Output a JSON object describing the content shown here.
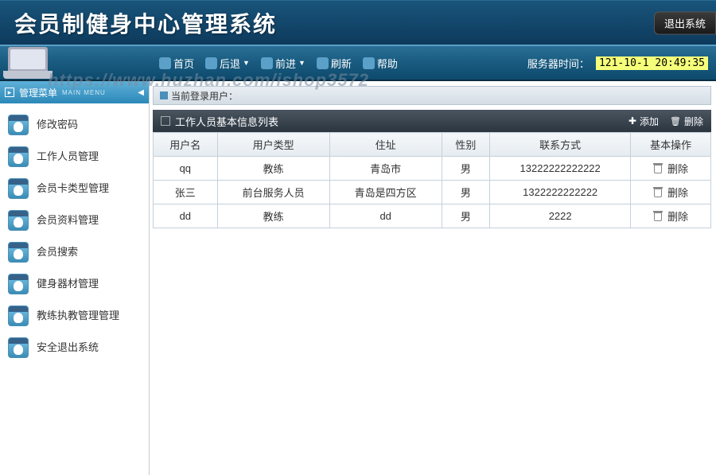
{
  "app_title": "会员制健身中心管理系统",
  "logout_label": "退出系统",
  "watermark": "https://www.huzhan.com/ishop3572",
  "nav": {
    "home": "首页",
    "back": "后退",
    "forward": "前进",
    "refresh": "刷新",
    "help": "帮助"
  },
  "server_time": {
    "label": "服务器时间：",
    "value": "121-10-1 20:49:35"
  },
  "sidebar": {
    "title": "管理菜单",
    "subtitle": "MAIN MENU",
    "items": [
      {
        "label": "修改密码"
      },
      {
        "label": "工作人员管理"
      },
      {
        "label": "会员卡类型管理"
      },
      {
        "label": "会员资料管理"
      },
      {
        "label": "会员搜索"
      },
      {
        "label": "健身器材管理"
      },
      {
        "label": "教练执教管理管理"
      },
      {
        "label": "安全退出系统"
      }
    ]
  },
  "breadcrumb": "当前登录用户：",
  "panel": {
    "title": "工作人员基本信息列表",
    "add": "添加",
    "delete": "删除"
  },
  "table": {
    "headers": [
      "用户名",
      "用户类型",
      "住址",
      "性别",
      "联系方式",
      "基本操作"
    ],
    "action_label": "删除",
    "rows": [
      {
        "username": "qq",
        "type": "教练",
        "addr": "青岛市",
        "gender": "男",
        "contact": "13222222222222"
      },
      {
        "username": "张三",
        "type": "前台服务人员",
        "addr": "青岛是四方区",
        "gender": "男",
        "contact": "1322222222222"
      },
      {
        "username": "dd",
        "type": "教练",
        "addr": "dd",
        "gender": "男",
        "contact": "2222"
      }
    ]
  }
}
